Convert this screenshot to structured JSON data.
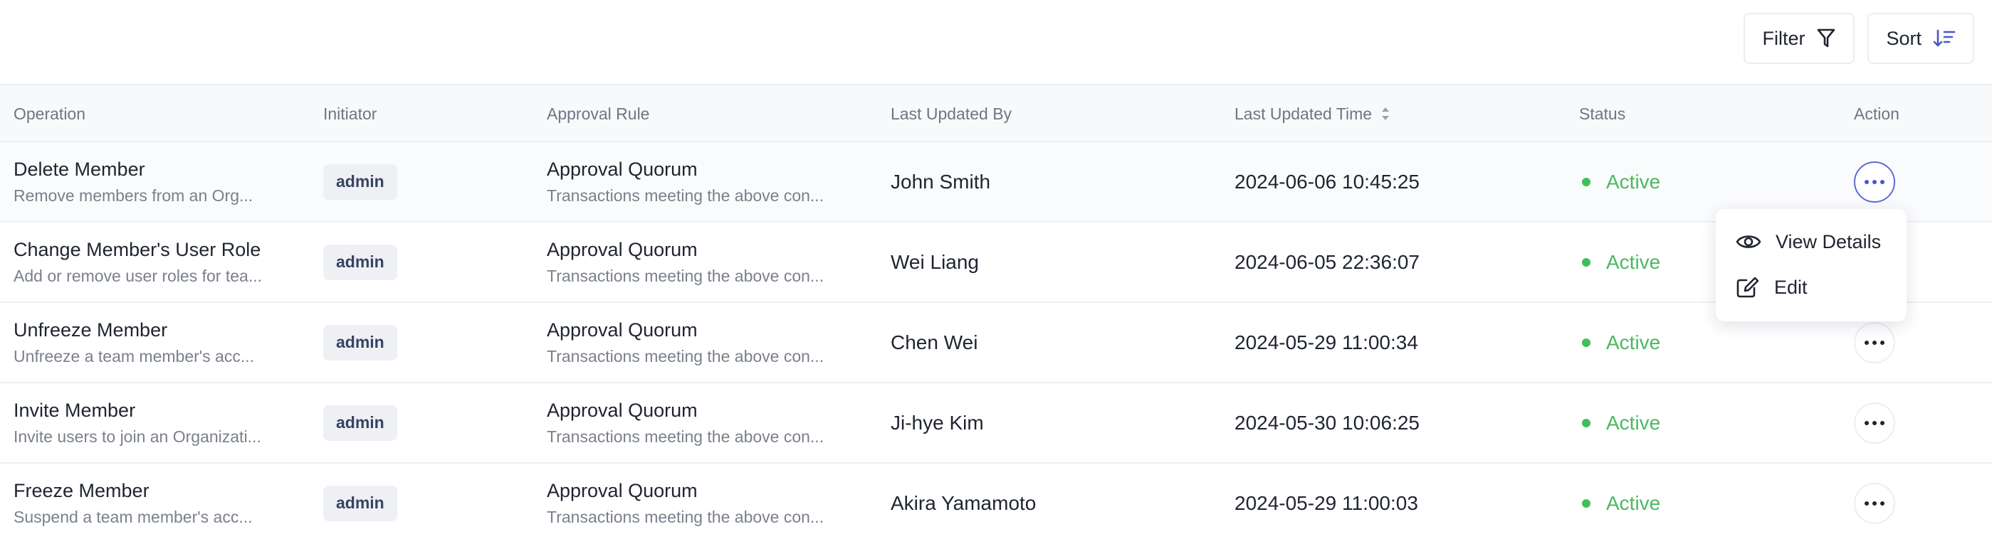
{
  "toolbar": {
    "filter_label": "Filter",
    "sort_label": "Sort"
  },
  "columns": {
    "operation": "Operation",
    "initiator": "Initiator",
    "approval_rule": "Approval Rule",
    "last_updated_by": "Last Updated By",
    "last_updated_time": "Last Updated Time",
    "status": "Status",
    "action": "Action"
  },
  "rows": [
    {
      "operation": "Delete Member",
      "operation_desc": "Remove members from an Org...",
      "initiator": "admin",
      "rule": "Approval Quorum",
      "rule_desc": "Transactions meeting the above con...",
      "updated_by": "John Smith",
      "updated_time": "2024-06-06 10:45:25",
      "status": "Active"
    },
    {
      "operation": "Change Member's User Role",
      "operation_desc": "Add or remove user roles for tea...",
      "initiator": "admin",
      "rule": "Approval Quorum",
      "rule_desc": "Transactions meeting the above con...",
      "updated_by": "Wei Liang",
      "updated_time": "2024-06-05 22:36:07",
      "status": "Active"
    },
    {
      "operation": "Unfreeze Member",
      "operation_desc": "Unfreeze a team member's acc...",
      "initiator": "admin",
      "rule": "Approval Quorum",
      "rule_desc": "Transactions meeting the above con...",
      "updated_by": "Chen Wei",
      "updated_time": "2024-05-29 11:00:34",
      "status": "Active"
    },
    {
      "operation": "Invite Member",
      "operation_desc": "Invite users to join an Organizati...",
      "initiator": "admin",
      "rule": "Approval Quorum",
      "rule_desc": "Transactions meeting the above con...",
      "updated_by": "Ji-hye Kim",
      "updated_time": "2024-05-30 10:06:25",
      "status": "Active"
    },
    {
      "operation": "Freeze Member",
      "operation_desc": "Suspend a team member's acc...",
      "initiator": "admin",
      "rule": "Approval Quorum",
      "rule_desc": "Transactions meeting the above con...",
      "updated_by": "Akira Yamamoto",
      "updated_time": "2024-05-29 11:00:03",
      "status": "Active"
    }
  ],
  "menu": {
    "view_details": "View Details",
    "edit": "Edit"
  },
  "icons": {
    "filter": "filter-icon",
    "sort": "sort-icon",
    "more": "more-horizontal-icon",
    "view": "eye-icon",
    "edit": "edit-icon",
    "sort_caret": "sort-caret-icon"
  },
  "colors": {
    "accent": "#5c6bd8",
    "status_active": "#4cb861",
    "chip_bg": "#eef0f4"
  }
}
